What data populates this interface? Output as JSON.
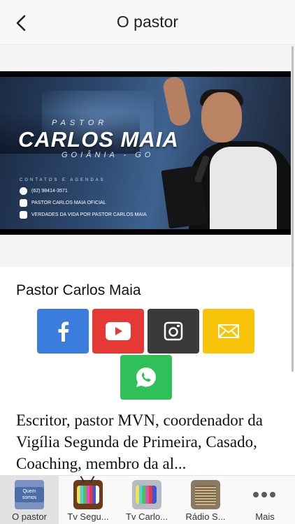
{
  "header": {
    "title": "O pastor",
    "back_icon": "chevron-left-icon"
  },
  "banner": {
    "title_small": "PASTOR",
    "title_big": "CARLOS MAIA",
    "city": "GOIÂNIA - GO",
    "contacts_heading": "CONTATOS E AGENDAS",
    "phone": "(62) 98414-3571",
    "instagram": "PASTOR CARLOS MAIA OFICIAL",
    "facebook": "VERDADES DA VIDA POR PASTOR CARLOS MAIA"
  },
  "profile": {
    "name": "Pastor Carlos Maia",
    "description": "Escritor, pastor MVN, coordenador da Vigília Segunda de Primeira, Casado, Coaching, membro da al...",
    "social": [
      {
        "network": "facebook",
        "icon": "facebook-icon",
        "color": "#3b7ddd"
      },
      {
        "network": "youtube",
        "icon": "youtube-icon",
        "color": "#e53935"
      },
      {
        "network": "instagram",
        "icon": "instagram-icon",
        "color": "#3a3a3a"
      },
      {
        "network": "email",
        "icon": "mail-icon",
        "color": "#f8c40a"
      },
      {
        "network": "whatsapp",
        "icon": "whatsapp-icon",
        "color": "#30c05a"
      }
    ]
  },
  "tabs": [
    {
      "label": "O pastor",
      "icon": "quem-somos-icon",
      "icon_text": "Quem somos",
      "active": true
    },
    {
      "label": "Tv Segu...",
      "icon": "tv-icon",
      "active": false
    },
    {
      "label": "Tv Carlo...",
      "icon": "tv-icon",
      "active": false
    },
    {
      "label": "Rádio S...",
      "icon": "radio-icon",
      "active": false
    },
    {
      "label": "Mais",
      "icon": "more-icon",
      "active": false
    }
  ]
}
